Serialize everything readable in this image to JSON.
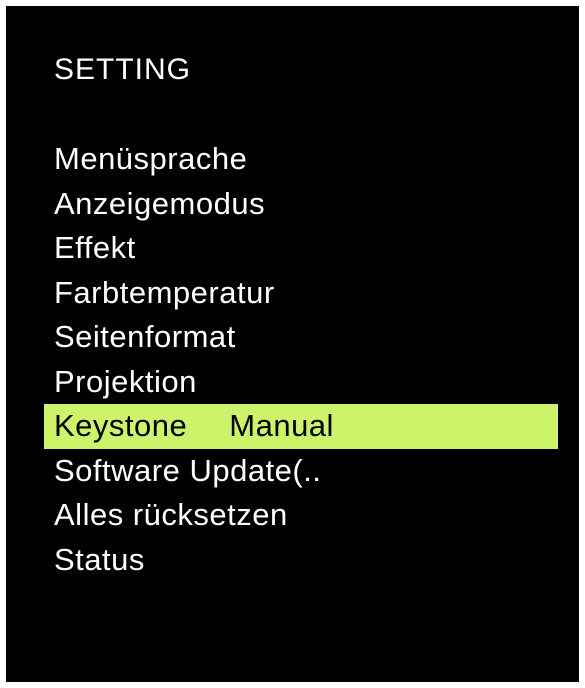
{
  "menu": {
    "title": "SETTING",
    "items": [
      {
        "label": "Menüsprache",
        "value": ""
      },
      {
        "label": "Anzeigemodus",
        "value": ""
      },
      {
        "label": "Effekt",
        "value": ""
      },
      {
        "label": "Farbtemperatur",
        "value": ""
      },
      {
        "label": "Seitenformat",
        "value": ""
      },
      {
        "label": "Projektion",
        "value": ""
      },
      {
        "label": "Keystone",
        "value": "Manual",
        "selected": true
      },
      {
        "label": "Software Update(..",
        "value": ""
      },
      {
        "label": "Alles rücksetzen",
        "value": ""
      },
      {
        "label": "Status",
        "value": ""
      }
    ]
  },
  "colors": {
    "background": "#000000",
    "text": "#ffffff",
    "selected_background": "#ccf36a",
    "selected_text": "#000000"
  }
}
